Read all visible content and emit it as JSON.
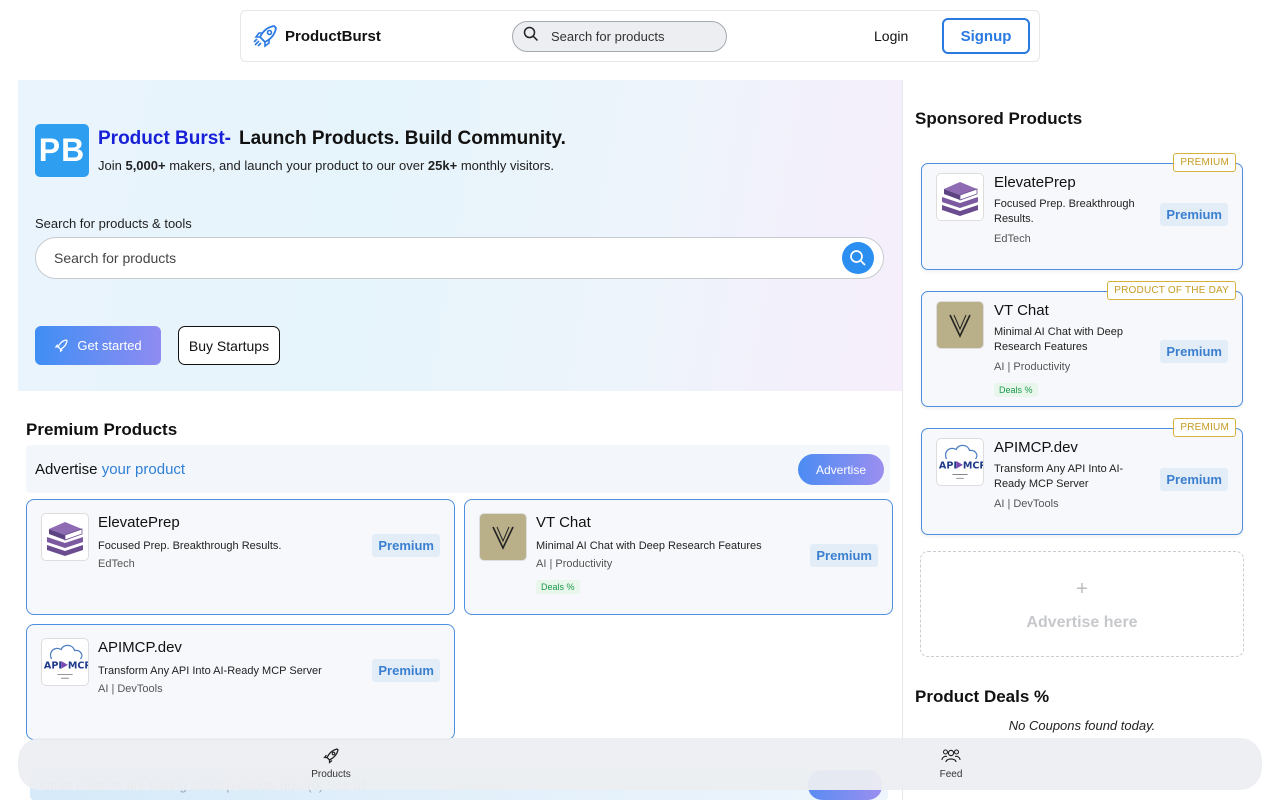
{
  "nav": {
    "brand": "ProductBurst",
    "search_placeholder": "Search for products",
    "login": "Login",
    "signup": "Signup"
  },
  "hero": {
    "logo_text": "PB",
    "title_accent": "Product Burst-",
    "title_rest": "Launch Products. Build Community.",
    "subtitle_parts": [
      "Join ",
      "5,000+",
      " makers, and launch your product to our over ",
      "25k+",
      " monthly visitors."
    ],
    "search_label": "Search for products & tools",
    "search_placeholder": "Search for products",
    "get_started": "Get started",
    "buy_startups": "Buy Startups"
  },
  "premium": {
    "title": "Premium Products",
    "advertise_prefix": "Advertise",
    "advertise_accent": "your product",
    "advertise_button": "Advertise",
    "cards": [
      {
        "name": "ElevatePrep",
        "description": "Focused Prep. Breakthrough Results.",
        "category": "EdTech",
        "badge": "Premium",
        "thumb_icon": "books-icon"
      },
      {
        "name": "VT Chat",
        "description": "Minimal AI Chat with Deep Research Features",
        "category": "AI | Productivity",
        "deals": "Deals %",
        "badge": "Premium",
        "thumb_icon": "vt-logo-icon"
      },
      {
        "name": "APIMCP.dev",
        "description": "Transform Any API Into AI-Ready MCP Server",
        "category": "AI | DevTools",
        "badge": "Premium",
        "thumb_icon": "apimcp-logo-icon"
      }
    ]
  },
  "sidebar": {
    "sponsored_title": "Sponsored Products",
    "cards": [
      {
        "flag": "PREMIUM",
        "name": "ElevatePrep",
        "description": "Focused Prep. Breakthrough Results.",
        "category": "EdTech",
        "badge": "Premium"
      },
      {
        "flag": "PRODUCT OF THE DAY",
        "name": "VT Chat",
        "description": "Minimal AI Chat with Deep Research Features",
        "category": "AI | Productivity",
        "deals": "Deals %",
        "badge": "Premium"
      },
      {
        "flag": "PREMIUM",
        "name": "APIMCP.dev",
        "description": "Transform Any API Into AI-Ready MCP Server",
        "category": "AI | DevTools",
        "badge": "Premium"
      }
    ],
    "advertise_plus": "+",
    "advertise_here": "Advertise here",
    "deals_title": "Product Deals %",
    "no_coupons": "No Coupons found today."
  },
  "below": {
    "text": "Other creators are talking about products now (0)  See all"
  },
  "bottom_tabs": [
    {
      "label": "Products",
      "icon": "rocket-icon"
    },
    {
      "label": "Feed",
      "icon": "users-icon"
    }
  ],
  "colors": {
    "accent_blue": "#2a7ae2",
    "title_blue": "#1820d8",
    "card_border": "#4f8fe0",
    "flag_gold": "#c79a22"
  }
}
